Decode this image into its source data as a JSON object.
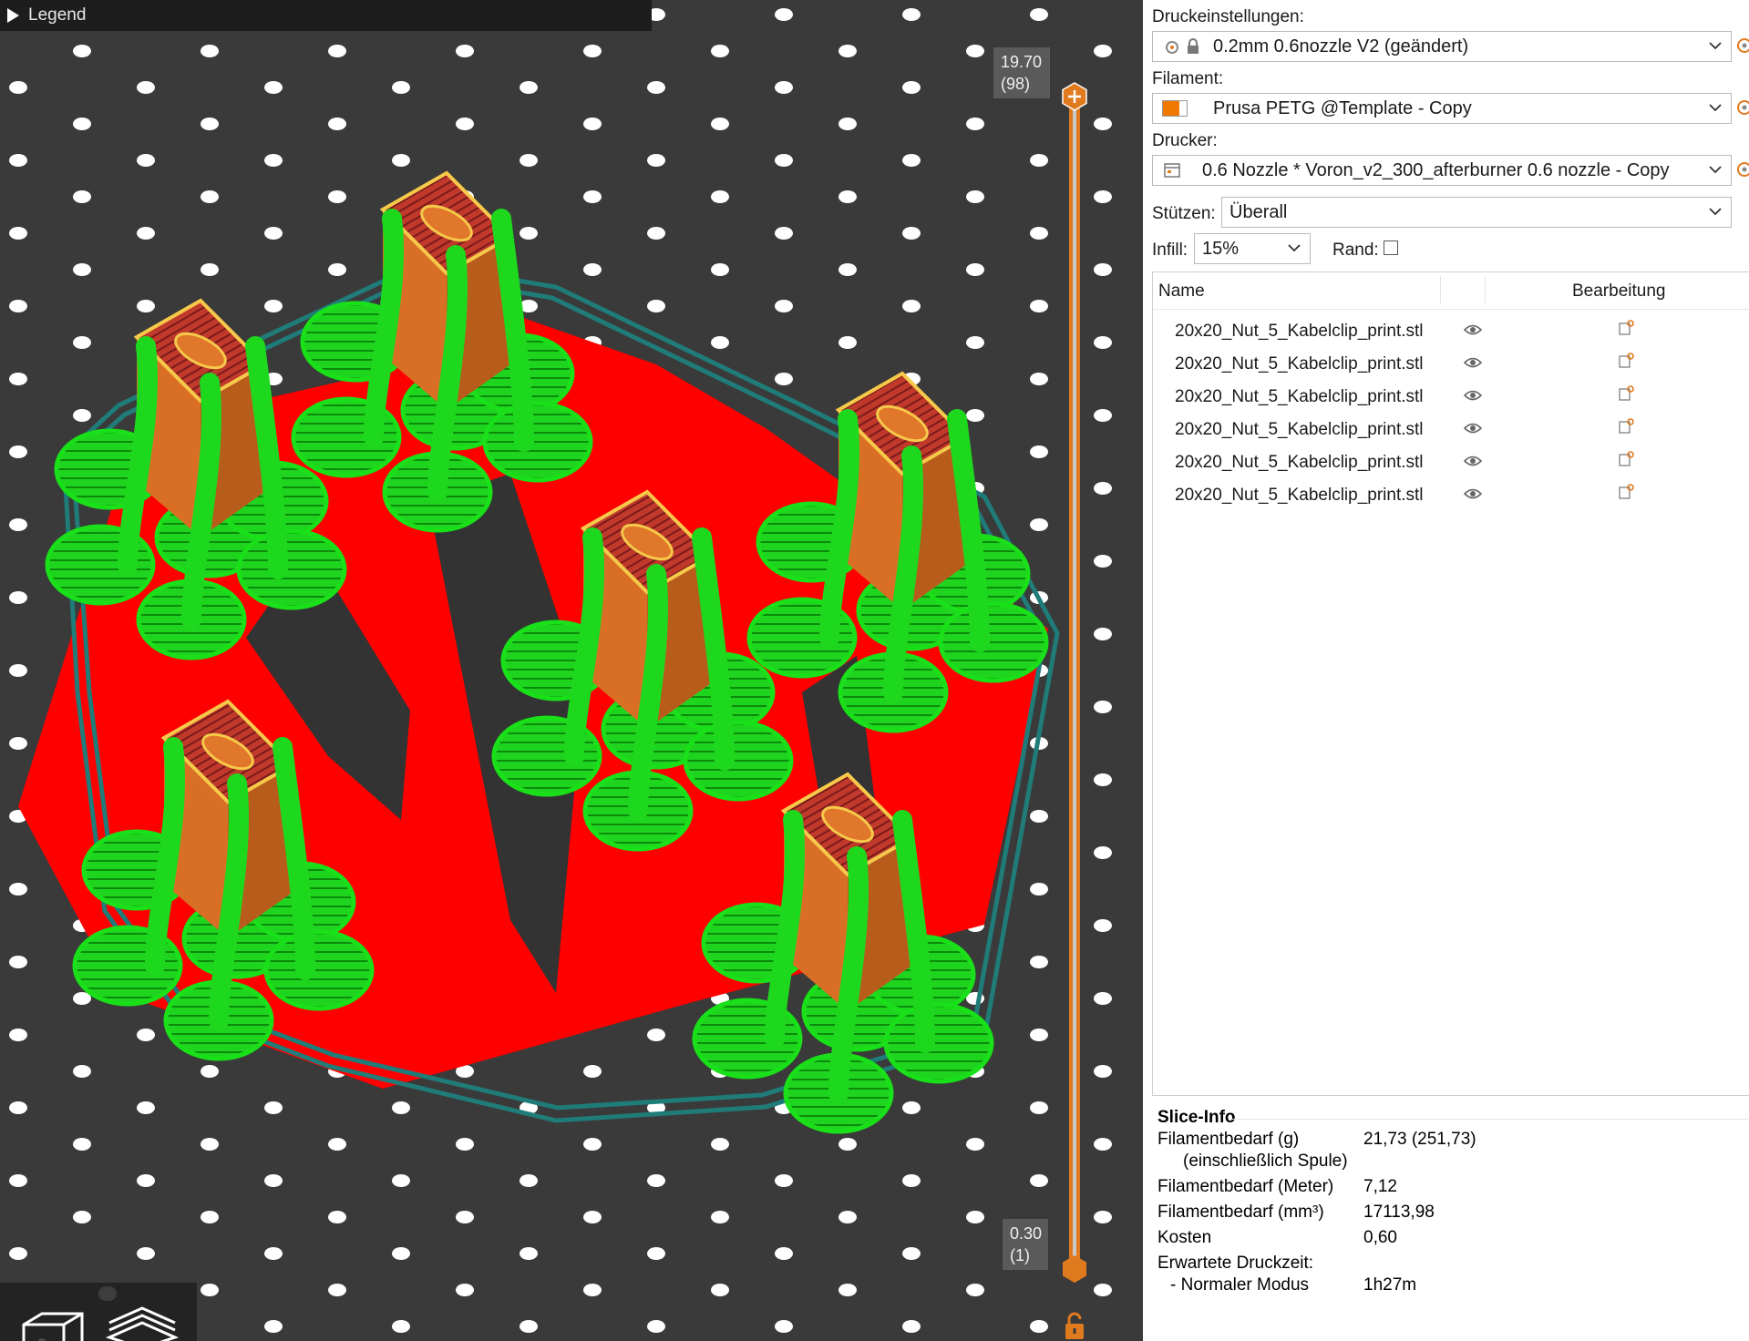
{
  "viewport": {
    "legend_label": "Legend",
    "layer_top": {
      "height": "19.70",
      "layer": "(98)"
    },
    "layer_bottom": {
      "height": "0.30",
      "layer": "(1)"
    },
    "colors": {
      "bed": "#3a3a3a",
      "bed_dots": "#ffffff",
      "support": "#19dc19",
      "part": "#e0772a",
      "skirt": "#1f7c78",
      "interface": "#ff0000",
      "slider": "#e07a1f"
    }
  },
  "panel": {
    "print_settings": {
      "label": "Druckeinstellungen:",
      "value": "0.2mm 0.6nozzle V2 (geändert)"
    },
    "filament": {
      "label": "Filament:",
      "value": "Prusa PETG @Template - Copy",
      "swatch": "#f07800"
    },
    "printer": {
      "label": "Drucker:",
      "value": "0.6 Nozzle * Voron_v2_300_afterburner 0.6 nozzle - Copy"
    },
    "supports": {
      "label": "Stützen:",
      "value": "Überall"
    },
    "infill": {
      "label": "Infill:",
      "value": "15%"
    },
    "brim": {
      "label": "Rand:",
      "checked": false
    },
    "object_list": {
      "col_name": "Name",
      "col_edit": "Bearbeitung",
      "objects": [
        {
          "name": "20x20_Nut_5_Kabelclip_print.stl"
        },
        {
          "name": "20x20_Nut_5_Kabelclip_print.stl"
        },
        {
          "name": "20x20_Nut_5_Kabelclip_print.stl"
        },
        {
          "name": "20x20_Nut_5_Kabelclip_print.stl"
        },
        {
          "name": "20x20_Nut_5_Kabelclip_print.stl"
        },
        {
          "name": "20x20_Nut_5_Kabelclip_print.stl"
        }
      ]
    },
    "slice_info": {
      "title": "Slice-Info",
      "rows": [
        {
          "key": "Filamentbedarf (g)",
          "value": "21,73 (251,73)"
        },
        {
          "key": "(einschließlich Spule)",
          "value": ""
        },
        {
          "key": "Filamentbedarf (Meter)",
          "value": "7,12"
        },
        {
          "key": "Filamentbedarf (mm³)",
          "value": "17113,98"
        },
        {
          "key": "Kosten",
          "value": "0,60"
        },
        {
          "key": "Erwartete Druckzeit:",
          "value": ""
        },
        {
          "key": "- Normaler Modus",
          "value": "1h27m"
        }
      ]
    }
  }
}
